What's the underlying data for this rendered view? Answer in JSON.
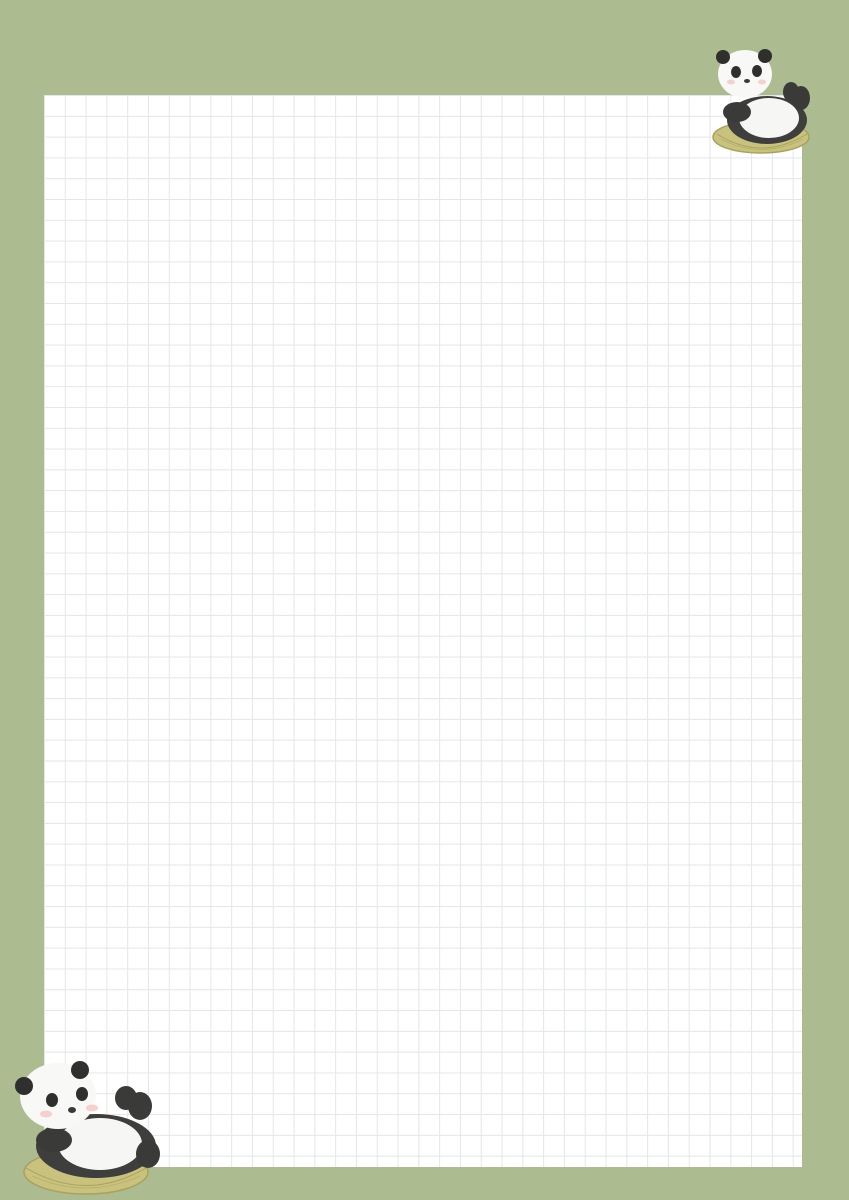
{
  "page": {
    "background_color": "#adbb90",
    "sheet_color": "#ffffff",
    "grid_line_color": "#e3e6ea"
  },
  "decorations": {
    "top_right": {
      "icon": "panda-in-basket-icon"
    },
    "bottom_left": {
      "icon": "panda-in-basket-icon"
    }
  }
}
